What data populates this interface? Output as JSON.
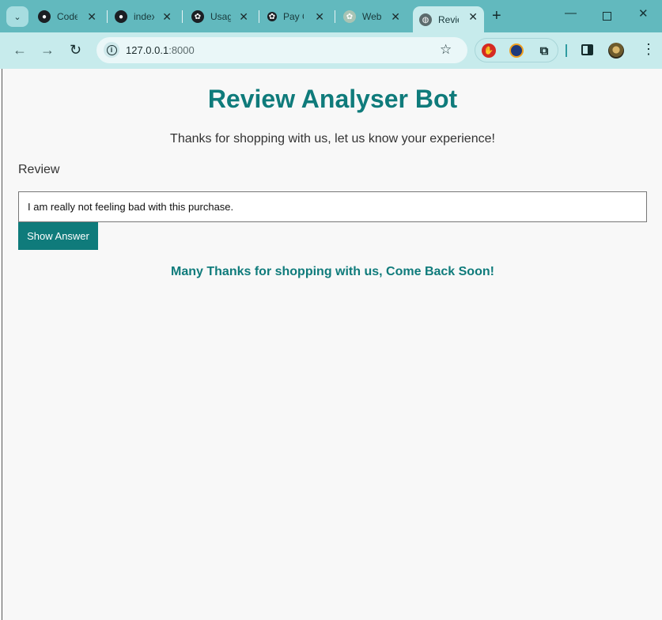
{
  "browser": {
    "tabs": [
      {
        "title": "Code",
        "icon": "github-icon"
      },
      {
        "title": "index",
        "icon": "github-icon"
      },
      {
        "title": "Usage",
        "icon": "openai-icon"
      },
      {
        "title": "Pay C",
        "icon": "openai-icon"
      },
      {
        "title": "Web",
        "icon": "openai-icon"
      },
      {
        "title": "Review",
        "icon": "globe-icon"
      }
    ],
    "url_host": "127.0.0.1",
    "url_port": ":8000"
  },
  "page": {
    "title": "Review Analyser Bot",
    "subtitle": "Thanks for shopping with us, let us know your experience!",
    "review_label": "Review",
    "review_value": "I am really not feeling bad with this purchase.",
    "button_label": "Show Answer",
    "result": "Many Thanks for shopping with us, Come Back Soon!"
  },
  "colors": {
    "accent": "#0f7b7b",
    "tabbar": "#62b9be",
    "toolbar": "#c7ebec"
  }
}
